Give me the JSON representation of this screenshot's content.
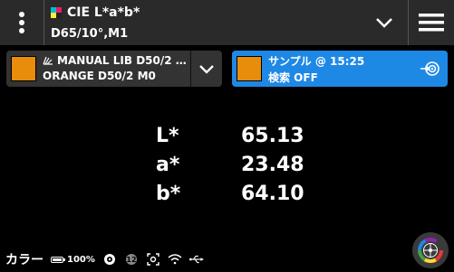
{
  "header": {
    "title": "CIE L*a*b*",
    "subtitle": "D65/10°,M1",
    "icons": [
      "menu-dots-icon",
      "cmy-icon",
      "chevron-down-icon",
      "hamburger-icon"
    ]
  },
  "library": {
    "line1": "MANUAL LIB D50/2 …",
    "line2": "ORANGE D50/2 M0",
    "swatch_color": "#e88c0c",
    "icon": "library-book-icon"
  },
  "sample": {
    "line1": "サンプル @ 15:25",
    "line2": "検索 OFF",
    "swatch_color": "#e88c0c",
    "panel_color": "#1e88e5",
    "icon": "measure-target-icon"
  },
  "measurements": [
    {
      "label": "L*",
      "value": "65.13"
    },
    {
      "label": "a*",
      "value": "23.48"
    },
    {
      "label": "b*",
      "value": "64.10"
    }
  ],
  "status": {
    "label": "カラー",
    "battery_percent": "100%",
    "battery_level": 1.0,
    "icons": [
      "battery-icon",
      "target-icon",
      "calibration-icon",
      "camera-focus-icon",
      "wifi-icon",
      "usb-icon"
    ]
  },
  "colors": {
    "accent_blue": "#1e88e5",
    "swatch_orange": "#e88c0c"
  }
}
